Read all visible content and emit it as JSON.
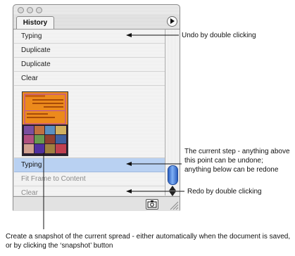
{
  "panel": {
    "tab_label": "History",
    "menu_icon": "triangle-right-icon",
    "rows_before": [
      {
        "label": "Typing"
      },
      {
        "label": "Duplicate"
      },
      {
        "label": "Duplicate"
      },
      {
        "label": "Clear"
      }
    ],
    "active_row": {
      "label": "Typing"
    },
    "rows_after": [
      {
        "label": "Fit Frame to Content"
      },
      {
        "label": "Clear"
      }
    ],
    "snapshot_button_icon": "camera-icon"
  },
  "callouts": {
    "undo": "Undo by double clicking",
    "current": "The current step - anything above this point can be undone; anything below can be redone",
    "redo": "Redo by double clicking",
    "snapshot": "Create a snapshot of the current spread - either automatically when the document is saved, or by clicking the ‘snapshot’ button"
  },
  "colors": {
    "active_row": "#b9d1f2",
    "scroll_thumb": "#3a74d6",
    "thumbnail_bg": "#e88a1a"
  }
}
